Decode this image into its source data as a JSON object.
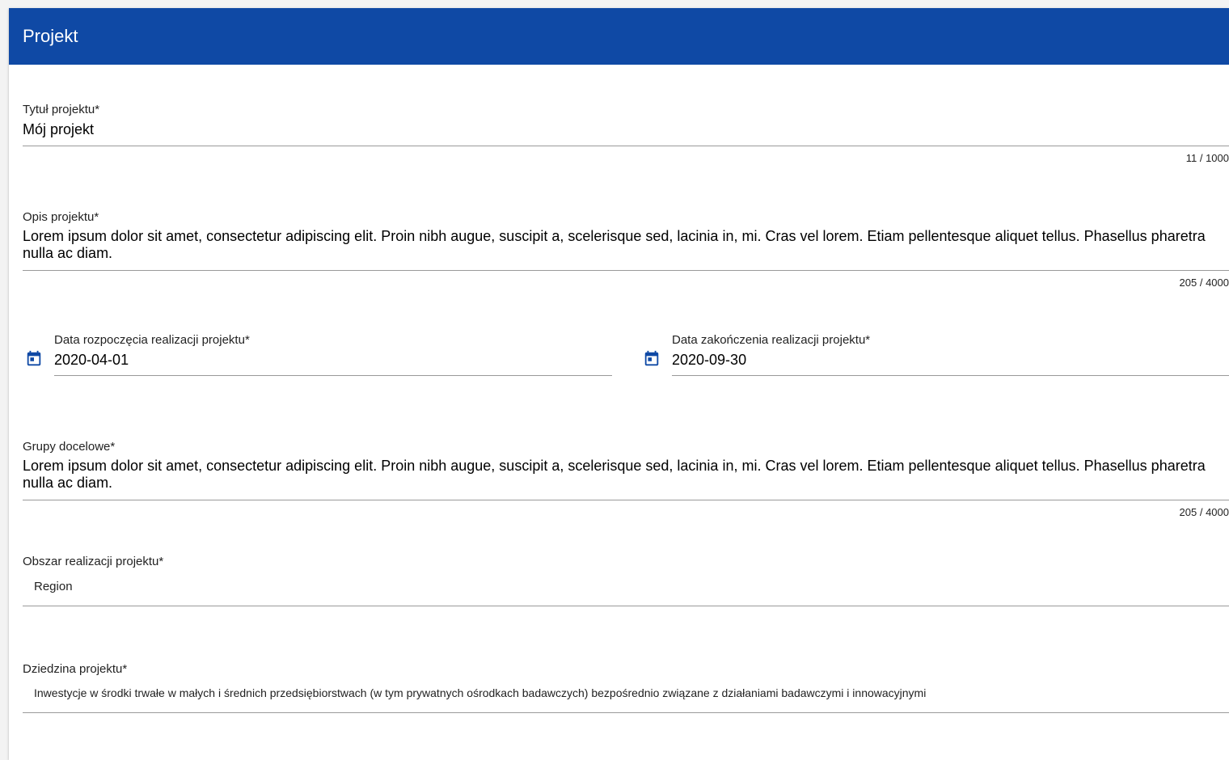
{
  "panel": {
    "title": "Projekt"
  },
  "fields": {
    "title": {
      "label": "Tytuł projektu*",
      "value": "Mój projekt",
      "counter": "11 / 1000"
    },
    "description": {
      "label": "Opis projektu*",
      "value": "Lorem ipsum dolor sit amet, consectetur adipiscing elit. Proin nibh augue, suscipit a, scelerisque sed, lacinia in, mi. Cras vel lorem. Etiam pellentesque aliquet tellus. Phasellus pharetra nulla ac diam.",
      "counter": "205 / 4000"
    },
    "start_date": {
      "label": "Data rozpoczęcia realizacji projektu*",
      "value": "2020-04-01",
      "icon": "calendar-icon"
    },
    "end_date": {
      "label": "Data zakończenia realizacji projektu*",
      "value": "2020-09-30",
      "icon": "calendar-icon"
    },
    "target_groups": {
      "label": "Grupy docelowe*",
      "value": "Lorem ipsum dolor sit amet, consectetur adipiscing elit. Proin nibh augue, suscipit a, scelerisque sed, lacinia in, mi. Cras vel lorem. Etiam pellentesque aliquet tellus. Phasellus pharetra nulla ac diam.",
      "counter": "205 / 4000"
    },
    "area": {
      "label": "Obszar realizacji projektu*",
      "value": "Region"
    },
    "domain": {
      "label": "Dziedzina projektu*",
      "value": "Inwestycje w środki trwałe w małych i średnich przedsiębiorstwach (w tym prywatnych ośrodkach badawczych) bezpośrednio związane z działaniami badawczymi i innowacyjnymi"
    }
  },
  "colors": {
    "header": "#0f49a5",
    "icon": "#0f49a5"
  }
}
